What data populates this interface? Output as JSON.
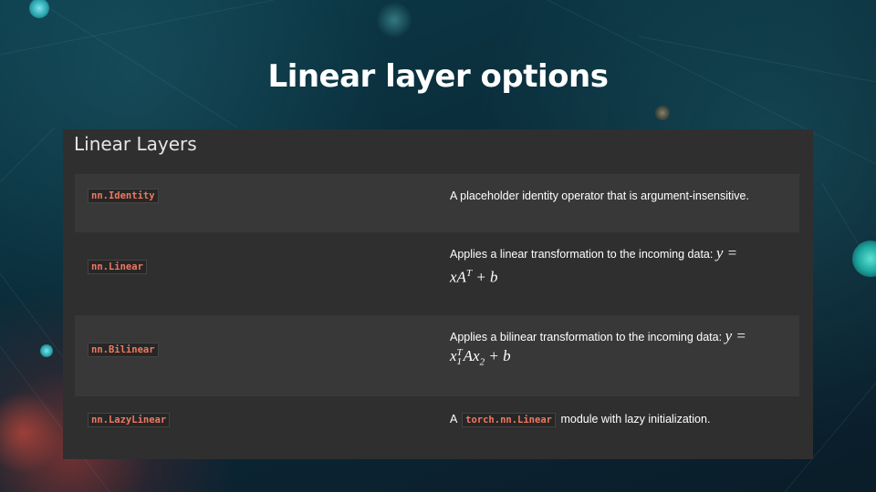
{
  "slide": {
    "title": "Linear layer options"
  },
  "panel": {
    "heading": "Linear Layers",
    "rows": [
      {
        "name": "nn.Identity",
        "description": "A placeholder identity operator that is argument-insensitive."
      },
      {
        "name": "nn.Linear",
        "description": "Applies a linear transformation to the incoming data:",
        "formula_head": "y =",
        "formula_tail": "xA",
        "formula_sup": "T",
        "formula_end": " + b"
      },
      {
        "name": "nn.Bilinear",
        "description": "Applies a bilinear transformation to the incoming data:",
        "formula_head": "y =",
        "formula_x": "x",
        "formula_sup": "T",
        "formula_sub": "1",
        "formula_mid": "Ax",
        "formula_sub2": "2",
        "formula_end": " + b"
      },
      {
        "name": "nn.LazyLinear",
        "description_prefix": "A",
        "inline_code": "torch.nn.Linear",
        "description_suffix": "module with lazy initialization."
      }
    ]
  },
  "colors": {
    "code_text": "#f07860",
    "panel_bg": "#2f2f2f",
    "row_shaded_bg": "#383838"
  }
}
